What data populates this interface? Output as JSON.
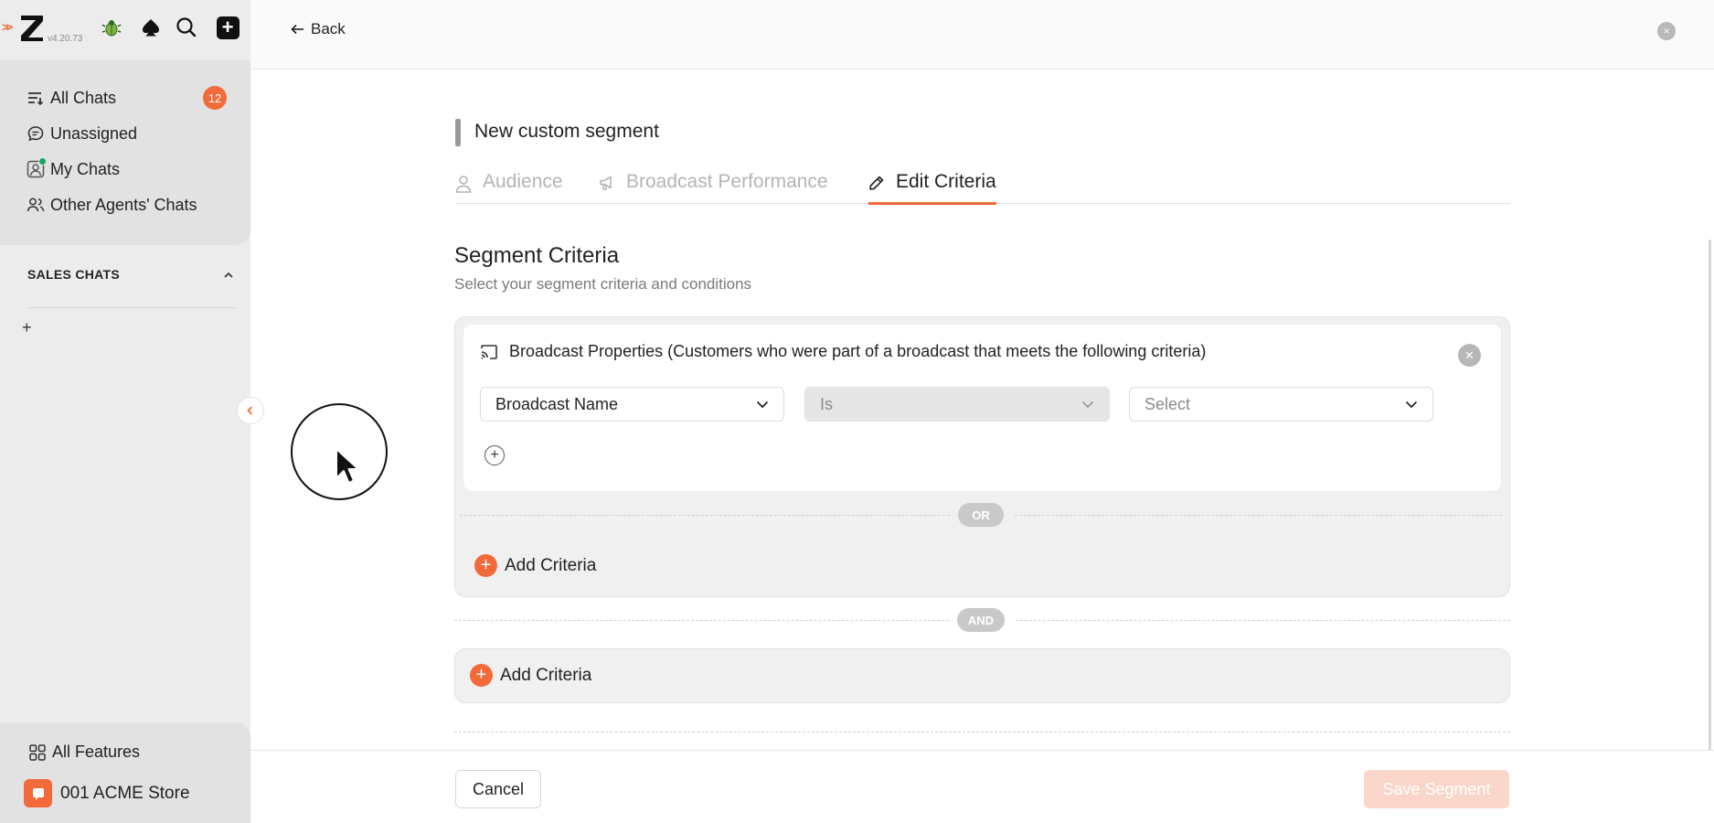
{
  "app": {
    "version": "v4.20.73",
    "accent_color": "#f26a3a"
  },
  "sidebar": {
    "nav": [
      {
        "label": "All Chats",
        "icon": "filter-list-icon",
        "count": "12"
      },
      {
        "label": "Unassigned",
        "icon": "chat-bubble-icon"
      },
      {
        "label": "My Chats",
        "icon": "user-chat-icon",
        "online": true
      },
      {
        "label": "Other Agents' Chats",
        "icon": "users-icon"
      }
    ],
    "section": {
      "title": "SALES CHATS",
      "add_label": "+"
    },
    "bottom": {
      "all_features": "All Features",
      "store_name": "001 ACME Store"
    }
  },
  "header": {
    "back_label": "Back",
    "close_label": "×"
  },
  "page": {
    "title": "New custom segment",
    "tabs": [
      {
        "label": "Audience",
        "icon": "person-icon",
        "active": false
      },
      {
        "label": "Broadcast Performance",
        "icon": "megaphone-icon",
        "active": false
      },
      {
        "label": "Edit Criteria",
        "icon": "pencil-icon",
        "active": true
      }
    ]
  },
  "criteria": {
    "heading": "Segment Criteria",
    "subheading": "Select your segment criteria and conditions",
    "group": {
      "card_title": "Broadcast Properties (Customers who were part of a broadcast that meets the following criteria)",
      "field": "Broadcast Name",
      "operator": "Is",
      "value_placeholder": "Select",
      "or_label": "OR",
      "add_label": "Add Criteria"
    },
    "and_label": "AND",
    "add_label": "Add Criteria"
  },
  "footer": {
    "cancel_label": "Cancel",
    "save_label": "Save Segment"
  }
}
